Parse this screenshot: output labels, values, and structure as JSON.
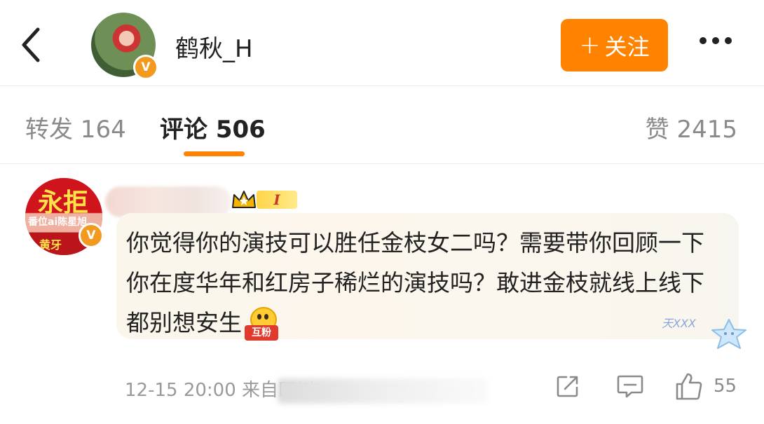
{
  "header": {
    "username": "鹤秋_H",
    "verified_badge": "V",
    "follow_button": {
      "plus": "+",
      "label": "关注"
    },
    "more_icon": "more-dots-icon",
    "back_icon": "chevron-left-icon"
  },
  "tabs": {
    "repost": "转发 164",
    "comments": "评论 506",
    "likes": "赞 2415"
  },
  "comment": {
    "avatar_text": {
      "line1": "永拒",
      "line2": "番位ai陈星旭",
      "line3": "黄牙"
    },
    "verified_badge": "V",
    "level_badge": "I",
    "text": "你觉得你的演技可以胜任金枝女二吗？需要带你回顾一下你在度华年和红房子稀烂的演技吗？敢进金枝就线上线下都别想安生",
    "emoji_label": "互粉",
    "watermark": "天XXX",
    "meta": "12-15 20:00 来自四川",
    "like_count": "55"
  },
  "colors": {
    "accent": "#ff8200",
    "verified": "#f29a1f",
    "bubble": "#fbf6ec"
  }
}
